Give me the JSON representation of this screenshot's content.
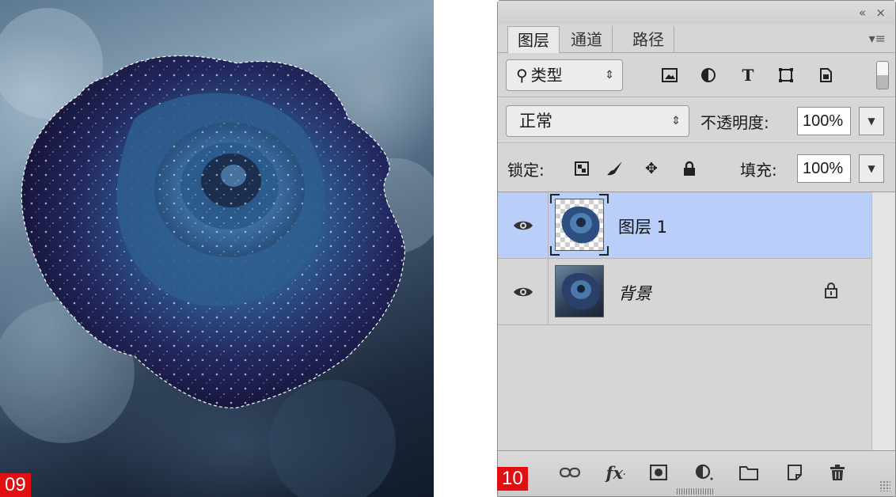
{
  "left_image": {
    "step_number": "09",
    "description_icon": "selected-rose-photo"
  },
  "right_panel": {
    "step_number": "10",
    "header": {
      "collapse_icon": "«",
      "close_icon": "×"
    },
    "tabs": [
      {
        "label": "图层",
        "active": true
      },
      {
        "label": "通道",
        "active": false
      },
      {
        "label": "路径",
        "active": false
      }
    ],
    "filter": {
      "label": "类型",
      "icons": [
        "pixel-layer-filter-icon",
        "adjustment-layer-filter-icon",
        "type-layer-filter-icon",
        "shape-layer-filter-icon",
        "smart-object-filter-icon"
      ]
    },
    "blend": {
      "mode": "正常",
      "opacity_label": "不透明度:",
      "opacity_value": "100%"
    },
    "lock": {
      "label": "锁定:",
      "icons": [
        "lock-transparent-pixels-icon",
        "lock-image-pixels-icon",
        "lock-position-icon",
        "lock-all-icon"
      ],
      "fill_label": "填充:",
      "fill_value": "100%"
    },
    "layers": [
      {
        "name": "图层 1",
        "visible": true,
        "selected": true,
        "locked": false
      },
      {
        "name": "背景",
        "visible": true,
        "selected": false,
        "locked": true
      }
    ],
    "bottom_icons": [
      "link-layers-icon",
      "layer-style-fx-icon",
      "add-mask-icon",
      "adjustment-layer-icon",
      "new-group-folder-icon",
      "new-layer-icon",
      "delete-trash-icon"
    ],
    "colors": {
      "panel_bg": "#d6d6d6",
      "selected_layer": "#b9cffa",
      "badge_red": "#e10e12"
    }
  }
}
